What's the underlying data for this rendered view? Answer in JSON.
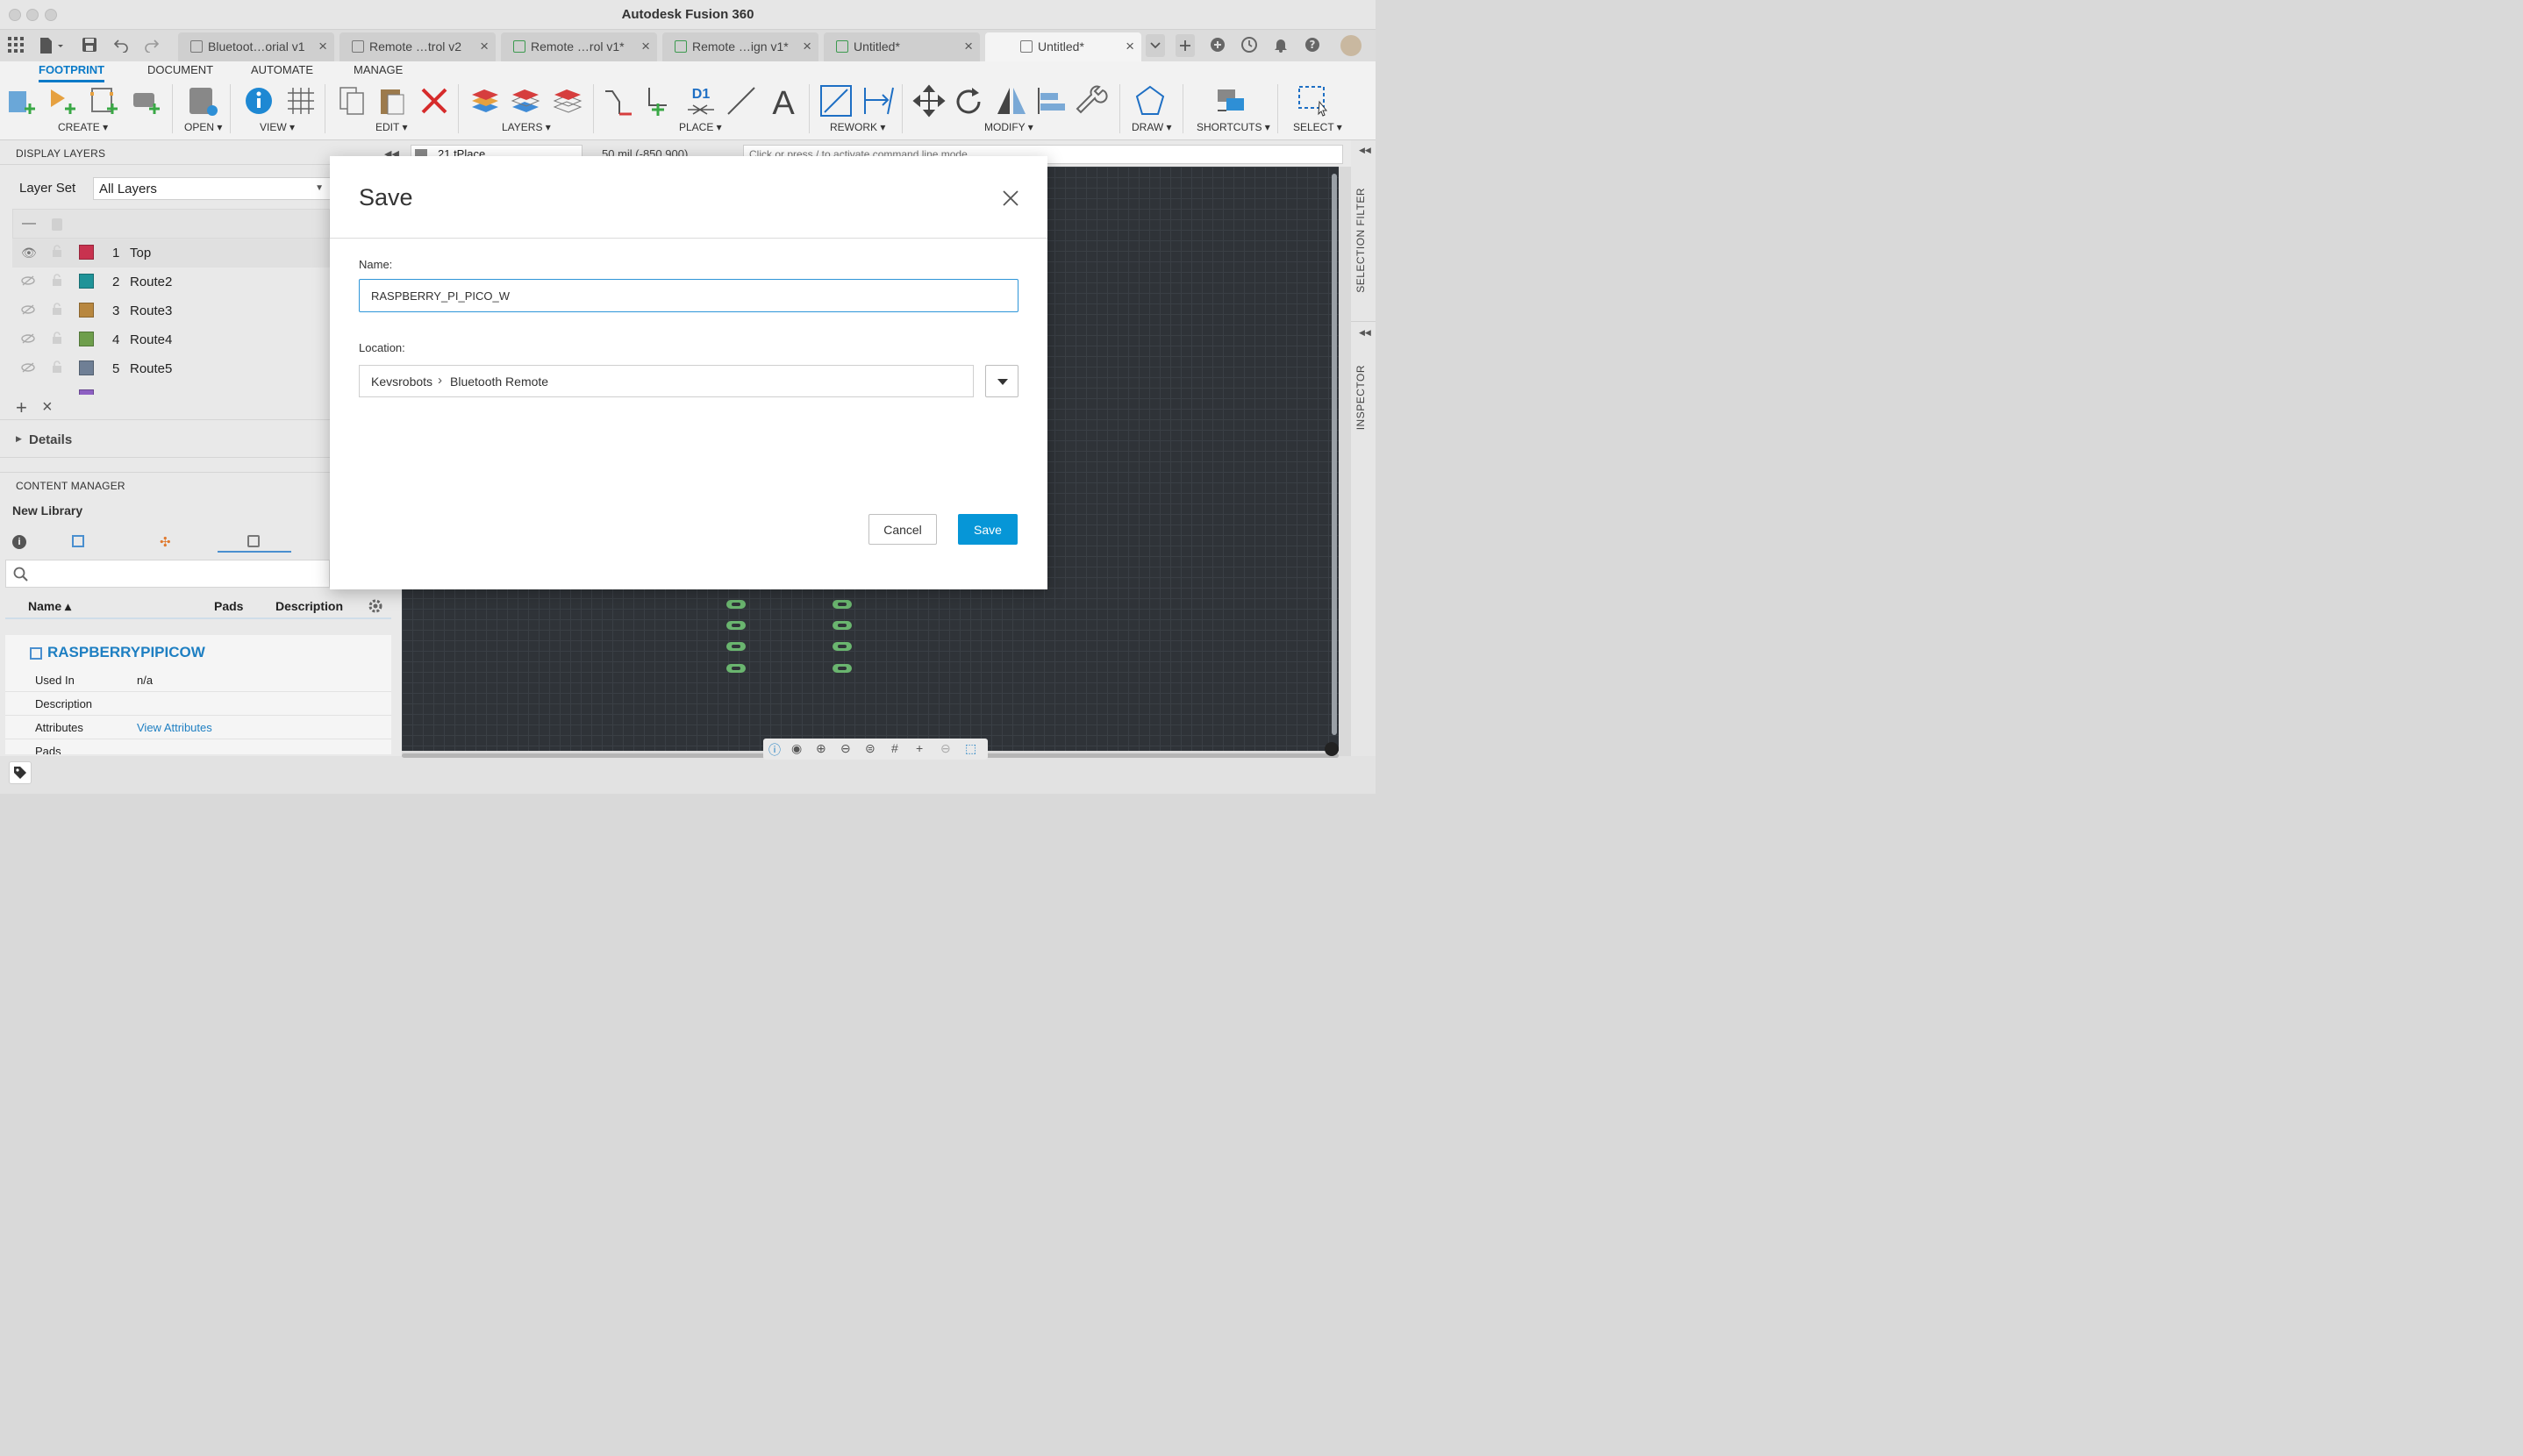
{
  "window": {
    "title": "Autodesk Fusion 360"
  },
  "tabs": [
    {
      "label": "Bluetoot…orial v1"
    },
    {
      "label": "Remote …trol v2"
    },
    {
      "label": "Remote …rol v1*"
    },
    {
      "label": "Remote …ign v1*"
    },
    {
      "label": "Untitled*"
    },
    {
      "label": "Untitled*",
      "active": true
    }
  ],
  "ribbon": {
    "tabs": [
      "FOOTPRINT",
      "DOCUMENT",
      "AUTOMATE",
      "MANAGE"
    ],
    "groups": [
      "CREATE ▾",
      "OPEN ▾",
      "VIEW ▾",
      "EDIT ▾",
      "LAYERS ▾",
      "PLACE ▾",
      "REWORK ▾",
      "MODIFY ▾",
      "DRAW ▾",
      "SHORTCUTS ▾",
      "SELECT ▾"
    ],
    "place_text_icon": "D1",
    "draw_text_icon": "A"
  },
  "display_layers": {
    "header": "DISPLAY LAYERS",
    "layer_set_label": "Layer Set",
    "layer_set_value": "All Layers",
    "layers": [
      {
        "num": "1",
        "name": "Top",
        "color": "#c8324f",
        "visible": true
      },
      {
        "num": "2",
        "name": "Route2",
        "color": "#1f9398",
        "visible": false
      },
      {
        "num": "3",
        "name": "Route3",
        "color": "#b8873f",
        "visible": false
      },
      {
        "num": "4",
        "name": "Route4",
        "color": "#6e9e4c",
        "visible": false
      },
      {
        "num": "5",
        "name": "Route5",
        "color": "#6f7f95",
        "visible": false
      }
    ],
    "details_label": "Details"
  },
  "content_manager": {
    "header": "CONTENT MANAGER",
    "library_name": "New Library",
    "columns": [
      "Name ▴",
      "Pads",
      "Description"
    ],
    "item_name": "RASPBERRYPIPICOW",
    "props": [
      {
        "label": "Used In",
        "value": "n/a"
      },
      {
        "label": "Description",
        "value": ""
      },
      {
        "label": "Attributes",
        "value": "View Attributes"
      },
      {
        "label": "Pads",
        "value": ""
      }
    ]
  },
  "command_bar": {
    "layer_value": "21 tPlace",
    "coords": "50 mil (-850 900)",
    "placeholder": "Click or press / to activate command line mode"
  },
  "right_panels": [
    "SELECTION FILTER",
    "INSPECTOR"
  ],
  "dialog": {
    "title": "Save",
    "name_label": "Name:",
    "name_value": "RASPBERRY_PI_PICO_W",
    "location_label": "Location:",
    "location_path": [
      "Kevsrobots",
      "Bluetooth Remote"
    ],
    "cancel_label": "Cancel",
    "save_label": "Save"
  },
  "colors": {
    "accent": "#0696d7",
    "canvas": "#2f3338",
    "pad": "#6ab56f"
  }
}
